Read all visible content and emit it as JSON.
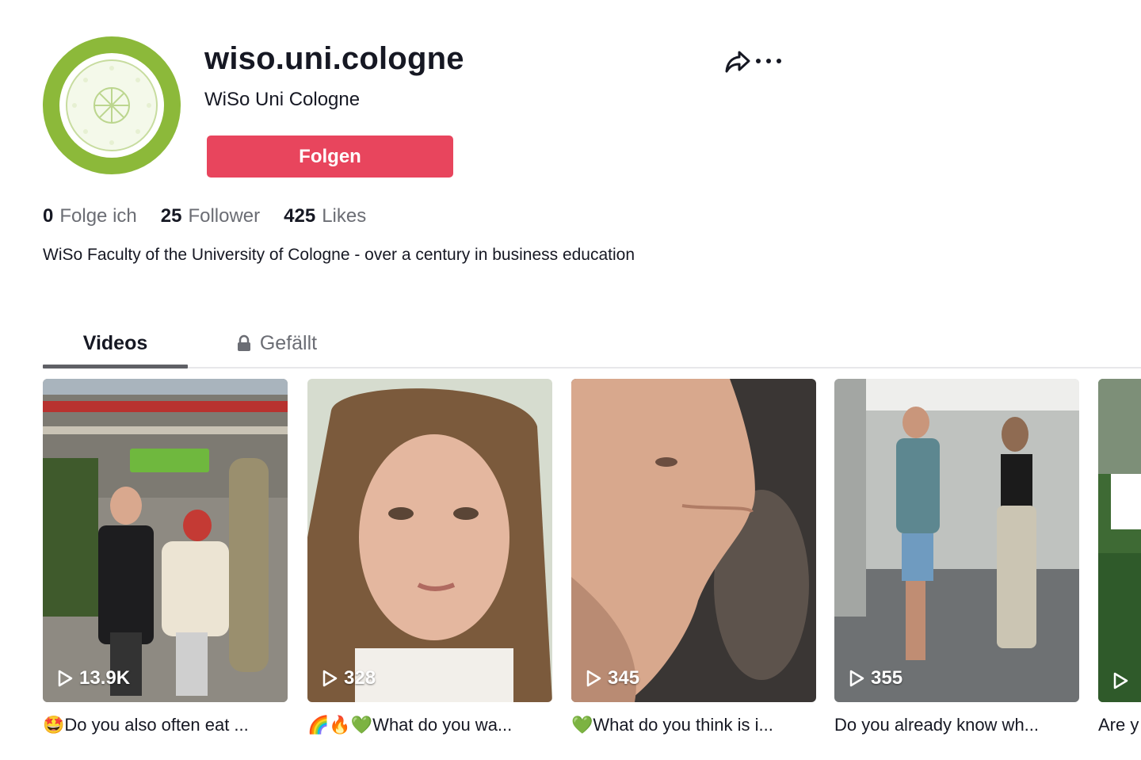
{
  "profile": {
    "username": "wiso.uni.cologne",
    "nickname": "WiSo Uni Cologne",
    "follow_label": "Folgen",
    "bio": "WiSo Faculty of the University of Cologne - over a century in business education"
  },
  "stats": [
    {
      "value": "0",
      "label": "Folge ich"
    },
    {
      "value": "25",
      "label": "Follower"
    },
    {
      "value": "425",
      "label": "Likes"
    }
  ],
  "tabs": [
    {
      "label": "Videos",
      "active": true
    },
    {
      "label": "Gefällt",
      "locked": true
    }
  ],
  "videos": [
    {
      "views": "13.9K",
      "caption": "🤩Do you also often eat ..."
    },
    {
      "views": "328",
      "caption": "🌈🔥💚What do you wa..."
    },
    {
      "views": "345",
      "caption": "💚What do you think is i..."
    },
    {
      "views": "355",
      "caption": "Do you already know wh..."
    },
    {
      "views": "",
      "caption": "Are y"
    }
  ],
  "colors": {
    "accent": "#e8455d",
    "avatar_green": "#8cb93a",
    "text": "#161823",
    "muted": "#6b6d74"
  },
  "icons": {
    "share": "share-icon",
    "more": "more-icon",
    "lock": "lock-icon",
    "play": "play-icon"
  }
}
